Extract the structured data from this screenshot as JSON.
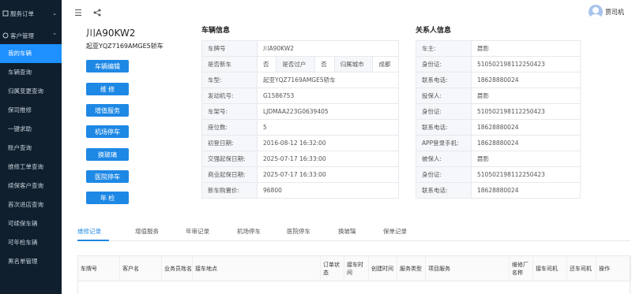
{
  "sidebar": {
    "top_item": "服务订单",
    "section": "客户管理",
    "items": [
      "我的车辆",
      "车辆查询",
      "归属变更查询",
      "保司推修",
      "一键求助",
      "账户查询",
      "维修工单查询",
      "续保客户查询",
      "首次进店查询",
      "可续保车辆",
      "可年检车辆",
      "黑名单管理"
    ]
  },
  "header": {
    "user_name": "贾司机"
  },
  "vehicle": {
    "plate": "川A90KW2",
    "model": "起亚YQZ7169AMGE5轿车"
  },
  "actions": [
    "车辆编辑",
    "维 修",
    "增值服务",
    "机场停车",
    "换玻璃",
    "医院停车",
    "年 检"
  ],
  "vehicle_info": {
    "title": "车辆信息",
    "plate_label": "车牌号",
    "plate_value": "川A90KW2",
    "new_car_label": "是否新车",
    "new_car_value": "否",
    "transfer_label": "是否过户",
    "transfer_value": "否",
    "city_label": "归属城市",
    "city_value": "成都",
    "rows": [
      {
        "k": "车型:",
        "v": "起亚YQZ7169AMGE5轿车"
      },
      {
        "k": "发动机号:",
        "v": "G1586753"
      },
      {
        "k": "车架号:",
        "v": "LJDMAA223G0639405"
      },
      {
        "k": "座位数:",
        "v": "5"
      },
      {
        "k": "初登日期:",
        "v": "2016-08-12 16:32:00"
      },
      {
        "k": "交强起保日期:",
        "v": "2025-07-17 16:33:00"
      },
      {
        "k": "商业起保日期:",
        "v": "2025-07-17 16:33:00"
      },
      {
        "k": "新车购置价:",
        "v": "96800"
      }
    ]
  },
  "contacts": {
    "title": "关系人信息",
    "rows": [
      {
        "k": "车主:",
        "v": "聂影"
      },
      {
        "k": "身份证:",
        "v": "510502198112250423"
      },
      {
        "k": "联系电话:",
        "v": "18628880024"
      },
      {
        "k": "投保人:",
        "v": "聂影"
      },
      {
        "k": "身份证:",
        "v": "510502198112250423"
      },
      {
        "k": "联系电话:",
        "v": "18628880024"
      },
      {
        "k": "APP登录手机:",
        "v": "18628880024"
      },
      {
        "k": "被保人:",
        "v": "聂影"
      },
      {
        "k": "身份证:",
        "v": "510502198112250423"
      },
      {
        "k": "联系电话:",
        "v": "18628880024"
      }
    ]
  },
  "tabs": [
    "维修记录",
    "增值服务",
    "年审记录",
    "机场停车",
    "医院停车",
    "换玻璃",
    "保单记录"
  ],
  "table": {
    "columns": [
      "车牌号",
      "客户名",
      "业务员姓名",
      "接车地点",
      "订单状态",
      "接车时间",
      "创建时间",
      "服务类型",
      "项目服务",
      "维修厂名称",
      "接车司机",
      "还车司机",
      "操作"
    ]
  },
  "icons": [
    "chevron-down-icon",
    "chevron-up-icon",
    "menu-fold-icon",
    "share-icon",
    "user-avatar-icon"
  ],
  "colors": {
    "sidebar_bg": "#0f1f2e",
    "accent": "#1e88e5"
  }
}
